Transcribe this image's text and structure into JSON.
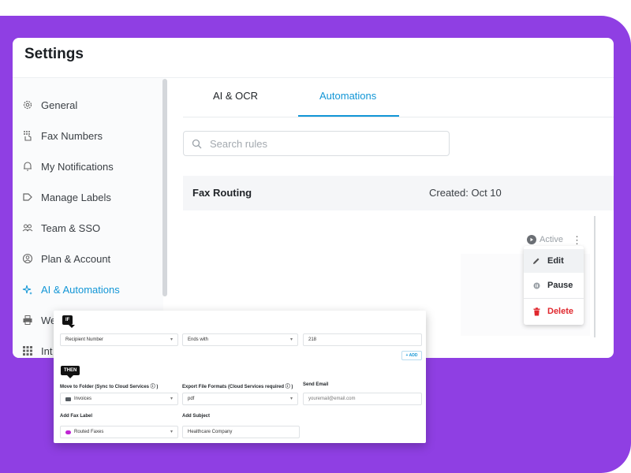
{
  "window": {
    "title": "Settings"
  },
  "sidebar": {
    "items": [
      {
        "label": "General",
        "icon": "gear-icon"
      },
      {
        "label": "Fax Numbers",
        "icon": "fax-keypad-icon"
      },
      {
        "label": "My Notifications",
        "icon": "bell-icon"
      },
      {
        "label": "Manage Labels",
        "icon": "label-icon"
      },
      {
        "label": "Team & SSO",
        "icon": "team-icon"
      },
      {
        "label": "Plan & Account",
        "icon": "account-icon"
      },
      {
        "label": "AI & Automations",
        "icon": "sparkle-icon",
        "active": true
      },
      {
        "label": "We",
        "icon": "printer-icon"
      },
      {
        "label": "Int",
        "icon": "grid-icon"
      }
    ]
  },
  "tabs": [
    {
      "label": "AI & OCR"
    },
    {
      "label": "Automations",
      "active": true
    }
  ],
  "search": {
    "placeholder": "Search rules"
  },
  "rule": {
    "name": "Fax Routing",
    "created": "Created: Oct 10"
  },
  "status": {
    "label": "Active"
  },
  "menu": {
    "items": [
      "Edit",
      "Pause",
      "Delete"
    ]
  },
  "rule_editor": {
    "if_tag": "IF",
    "then_tag": "THEN",
    "condition": {
      "field": "Recipient Number",
      "operator": "Ends with",
      "value": "218"
    },
    "add_label": "+ ADD",
    "actions": {
      "folder_label": "Move to Folder (Sync to Cloud Services ⓘ )",
      "folder_value": "Invoices",
      "formats_label": "Export File Formats (Cloud Services required ⓘ )",
      "formats_value": "pdf",
      "email_label": "Send Email",
      "email_placeholder": "youremail@email.com",
      "fax_label_label": "Add Fax Label",
      "fax_label_value": "Routed Faxes",
      "subject_label": "Add Subject",
      "subject_value": "Healthcare Company"
    }
  },
  "colors": {
    "accent": "#1296d6",
    "background": "#8f3fe3",
    "delete": "#e0282e",
    "label_swatch": "#c026d3",
    "folder_swatch": "#555b61"
  }
}
